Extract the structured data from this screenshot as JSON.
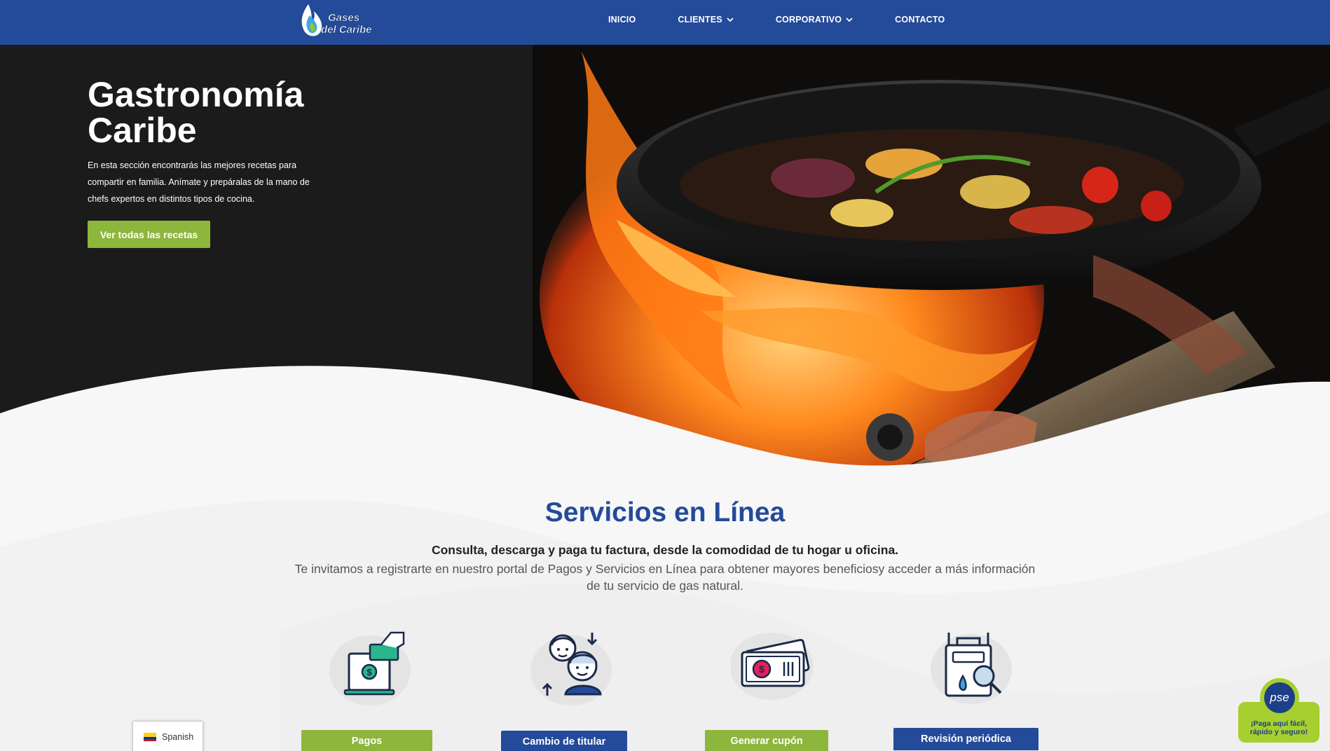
{
  "header": {
    "logo_text_line1": "Gases",
    "logo_text_line2": "del Caribe",
    "nav": [
      {
        "label": "INICIO",
        "has_dropdown": false
      },
      {
        "label": "CLIENTES",
        "has_dropdown": true
      },
      {
        "label": "CORPORATIVO",
        "has_dropdown": true
      },
      {
        "label": "CONTACTO",
        "has_dropdown": false
      }
    ]
  },
  "hero": {
    "title": "Gastronomía Caribe",
    "text": "En esta sección encontrarás las mejores recetas para compartir en familia. Anímate y prepáralas de la mano de chefs expertos en distintos tipos de cocina.",
    "button_label": "Ver todas las recetas"
  },
  "services": {
    "title": "Servicios en Línea",
    "subtitle": "Consulta, descarga y paga tu factura, desde la comodidad de tu hogar u oficina.",
    "description": "Te invitamos a registrarte en nuestro portal de Pagos y Servicios en Línea para obtener mayores beneficiosy acceder a más información de tu servicio de gas natural.",
    "cards": [
      {
        "label": "Pagos",
        "icon": "payment-laptop-icon",
        "color": "green"
      },
      {
        "label": "Cambio de titular",
        "icon": "change-owner-icon",
        "color": "blue"
      },
      {
        "label": "Generar cupón",
        "icon": "coupon-bill-icon",
        "color": "green"
      },
      {
        "label": "Revisión periódica",
        "icon": "meter-inspection-icon",
        "color": "blue"
      }
    ]
  },
  "language_switcher": {
    "label": "Spanish",
    "flag": "colombia-flag-icon"
  },
  "pse_widget": {
    "logo": "pse",
    "tagline_line1": "¡Paga aquí fácil,",
    "tagline_line2": "rápido y seguro!"
  },
  "colors": {
    "brand_blue": "#244a9a",
    "brand_green": "#8db63c",
    "pse_green": "#a6cf2f"
  }
}
